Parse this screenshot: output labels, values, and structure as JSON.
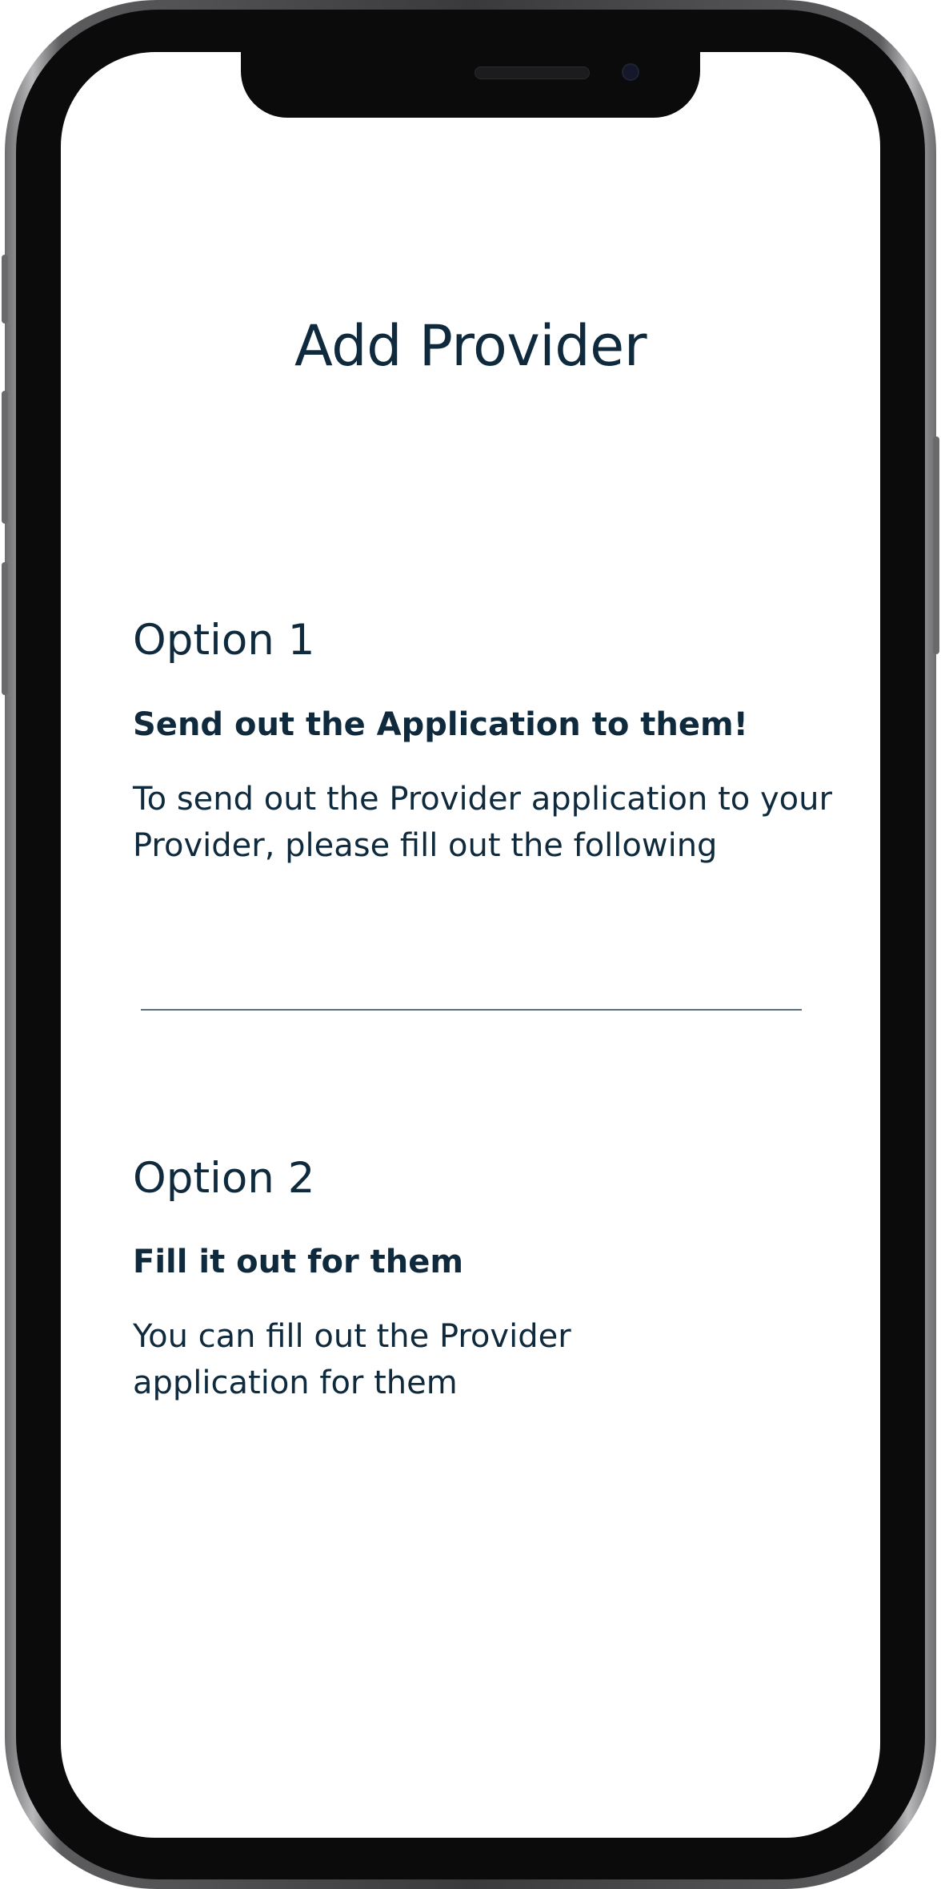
{
  "page": {
    "title": "Add Provider"
  },
  "options": [
    {
      "heading": "Option 1",
      "subtitle": "Send out the Application to them!",
      "body": "To send out the Provider application to your Provider, please fill out the following"
    },
    {
      "heading": "Option 2",
      "subtitle": "Fill it out for them",
      "body": "You can fill out the Provider application for them"
    }
  ],
  "colors": {
    "text": "#0f2a3d",
    "divider": "#5a6e7e",
    "background": "#ffffff",
    "device_frame": "#0b0b0c"
  }
}
